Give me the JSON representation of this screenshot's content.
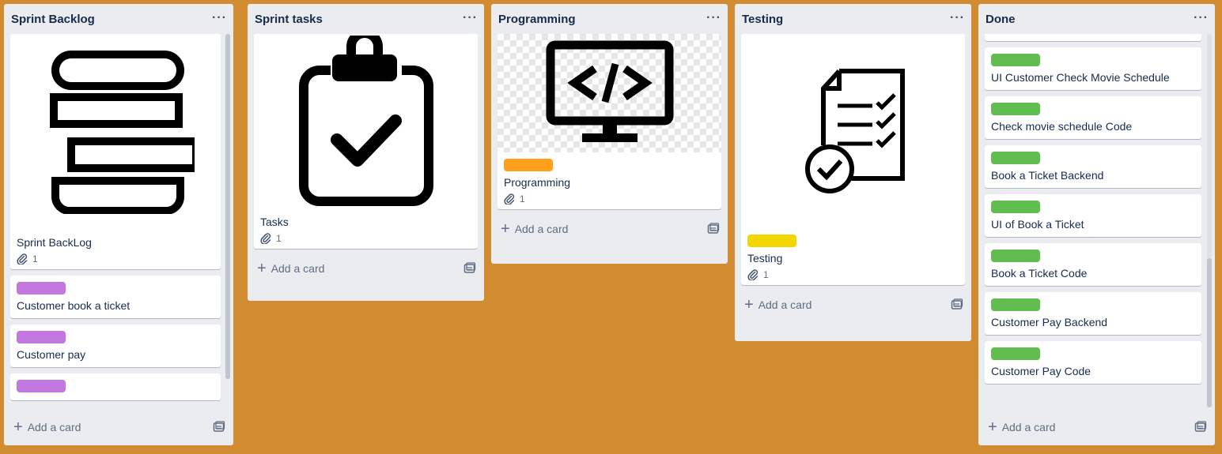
{
  "colors": {
    "board_bg": "#d18b31",
    "label_purple": "#c377e0",
    "label_orange": "#ff9f1a",
    "label_yellow": "#f2d600",
    "label_green": "#61bd4f"
  },
  "common": {
    "add_card_label": "Add a card",
    "menu_glyph": "···"
  },
  "lists": [
    {
      "title": "Sprint Backlog",
      "cards": [
        {
          "title": "Sprint BackLog",
          "cover_icon": "stack-icon",
          "attachments": "1"
        },
        {
          "title": "Customer book a ticket",
          "label_color": "purple"
        },
        {
          "title": "Customer pay",
          "label_color": "purple"
        },
        {
          "title": "",
          "label_color": "purple"
        }
      ]
    },
    {
      "title": "Sprint tasks",
      "cards": [
        {
          "title": "Tasks",
          "cover_icon": "clipboard-check-icon",
          "attachments": "1"
        }
      ]
    },
    {
      "title": "Programming",
      "cards": [
        {
          "title": "Programming",
          "cover_icon": "monitor-code-icon",
          "label_color": "orange",
          "attachments": "1"
        }
      ]
    },
    {
      "title": "Testing",
      "cards": [
        {
          "title": "Testing",
          "cover_icon": "document-checklist-icon",
          "label_color": "yellow",
          "attachments": "1"
        }
      ]
    },
    {
      "title": "Done",
      "cards": [
        {
          "title": "UI Customer Check Movie Schedule",
          "label_color": "green"
        },
        {
          "title": "Check movie schedule Code",
          "label_color": "green"
        },
        {
          "title": "Book a Ticket Backend",
          "label_color": "green"
        },
        {
          "title": "UI of Book a Ticket",
          "label_color": "green"
        },
        {
          "title": "Book a Ticket Code",
          "label_color": "green"
        },
        {
          "title": "Customer Pay Backend",
          "label_color": "green"
        },
        {
          "title": "Customer Pay Code",
          "label_color": "green"
        }
      ]
    }
  ]
}
